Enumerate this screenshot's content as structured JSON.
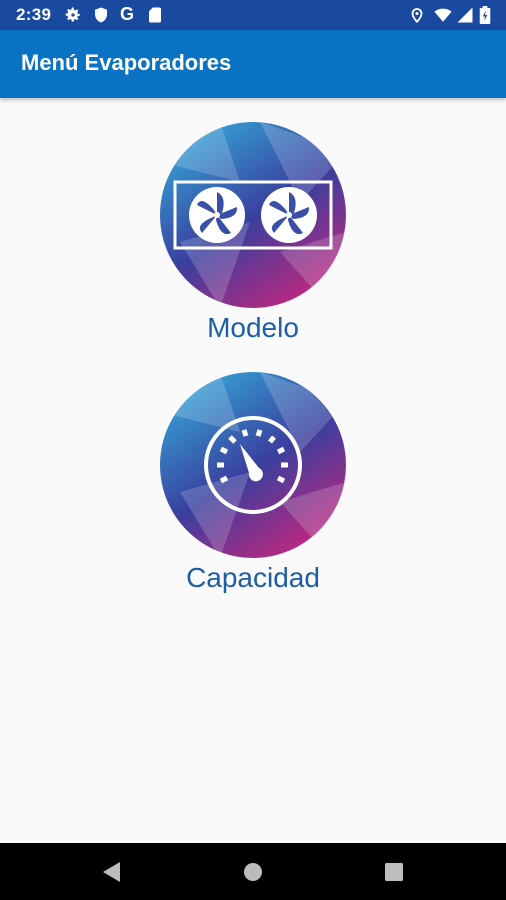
{
  "status_bar": {
    "time": "2:39",
    "left_icons": [
      "gear-icon",
      "shield-icon",
      "google-g-icon",
      "sd-card-icon"
    ],
    "google_letter": "G",
    "right_icons": [
      "location-icon",
      "wifi-icon",
      "signal-icon",
      "battery-icon"
    ]
  },
  "app_bar": {
    "title": "Menú Evaporadores"
  },
  "menu": {
    "items": [
      {
        "label": "Modelo",
        "icon": "evaporator-fans-icon"
      },
      {
        "label": "Capacidad",
        "icon": "gauge-icon"
      }
    ]
  },
  "nav_bar": {
    "buttons": [
      "back-icon",
      "home-icon",
      "recents-icon"
    ]
  },
  "colors": {
    "status_bar": "#1a4aa0",
    "app_bar": "#0a72c2",
    "label": "#1e5ea6",
    "background": "#fafafa",
    "circle_gradient": [
      "#34a6d8",
      "#3a3f9e",
      "#d0247a"
    ]
  }
}
